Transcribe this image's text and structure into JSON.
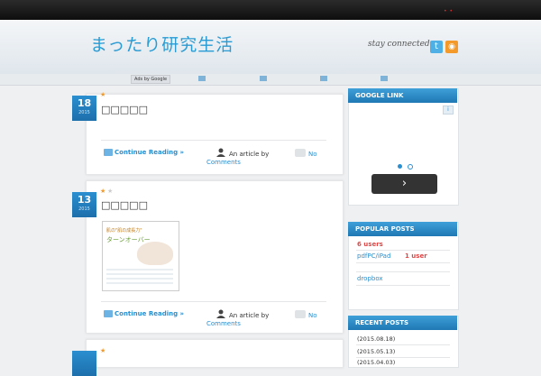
{
  "header": {
    "site_title": "まったり研究生活",
    "stay_connected": "stay connected →"
  },
  "ads": {
    "label": "Ads by Google"
  },
  "posts": [
    {
      "day": "18",
      "year": "2015",
      "title": "□□□□□",
      "continue": "Continue Reading »",
      "article_by": "An article by",
      "comments": "Comments",
      "comment_count": "No"
    },
    {
      "day": "13",
      "year": "2015",
      "title": "□□□□□",
      "continue": "Continue Reading »",
      "article_by": "An article by",
      "comments": "Comments",
      "comment_count": "No",
      "thumb": {
        "line1": "肌の\"肌の成長力\"",
        "line2": "ターンオーバー"
      }
    },
    {
      "day": "",
      "year": "",
      "title": "",
      "continue": "",
      "article_by": "",
      "comments": "",
      "comment_count": ""
    }
  ],
  "sidebar": {
    "google_link": {
      "title": "GOOGLE LINK",
      "next": "›",
      "info": "i"
    },
    "popular": {
      "title": "POPULAR POSTS",
      "items": [
        {
          "name": "",
          "count": "6 users"
        },
        {
          "name": "pdfPC/iPad",
          "count": "1 user"
        },
        {
          "name": "",
          "count": ""
        },
        {
          "name": "dropbox",
          "count": ""
        }
      ]
    },
    "recent": {
      "title": "RECENT POSTS",
      "items": [
        "(2015.08.18)",
        "(2015.05.13)",
        "(2015.04.03)"
      ]
    }
  },
  "icons": {
    "twitter": "twitter-icon",
    "rss": "rss-icon"
  },
  "colors": {
    "accent": "#2a8fd0",
    "popular_count": "#e04848",
    "logo": "#2a9bd3"
  }
}
